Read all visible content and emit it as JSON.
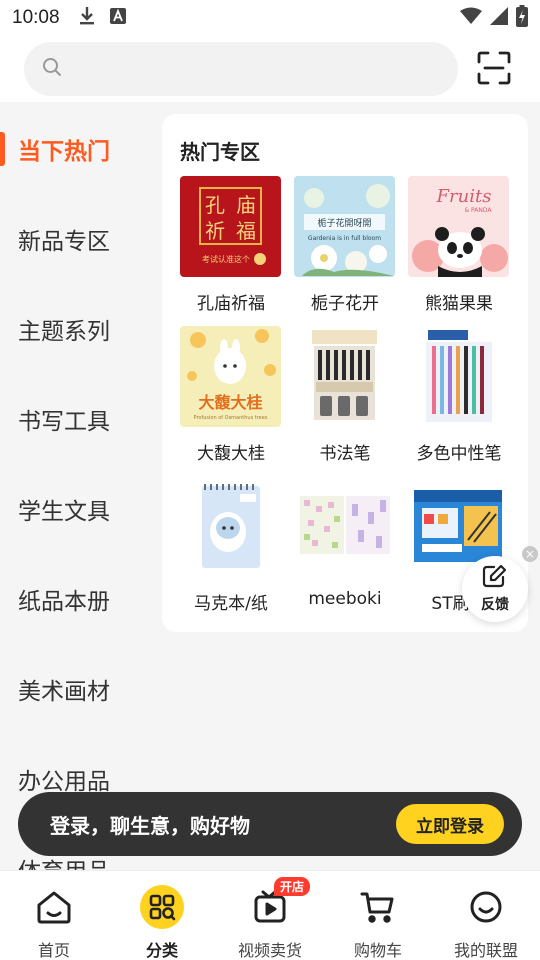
{
  "status_bar": {
    "time": "10:08"
  },
  "search": {
    "placeholder": ""
  },
  "sidebar": {
    "items": [
      {
        "label": "当下热门",
        "active": true
      },
      {
        "label": "新品专区",
        "active": false
      },
      {
        "label": "主题系列",
        "active": false
      },
      {
        "label": "书写工具",
        "active": false
      },
      {
        "label": "学生文具",
        "active": false
      },
      {
        "label": "纸品本册",
        "active": false
      },
      {
        "label": "美术画材",
        "active": false
      },
      {
        "label": "办公用品",
        "active": false
      },
      {
        "label": "体育用品",
        "active": false
      }
    ]
  },
  "content": {
    "section_title": "热门专区",
    "products": [
      {
        "name": "孔庙祈福",
        "thumb_text": [
          "孔",
          "庙",
          "祈",
          "福"
        ],
        "thumb_caption": "考试认准这个"
      },
      {
        "name": "栀子花开",
        "thumb_text": [
          "栀子花開呀開"
        ],
        "thumb_caption": "Gardenia is in full bloom"
      },
      {
        "name": "熊猫果果",
        "thumb_text": [
          "Fruits"
        ],
        "thumb_caption": "& PANDA"
      },
      {
        "name": "大馥大桂",
        "thumb_text": [
          "大馥大桂"
        ],
        "thumb_caption": "Profusion of Osmanthus trees"
      },
      {
        "name": "书法笔",
        "thumb_text": [],
        "thumb_caption": ""
      },
      {
        "name": "多色中性笔",
        "thumb_text": [],
        "thumb_caption": ""
      },
      {
        "name": "马克本/纸",
        "thumb_text": [],
        "thumb_caption": ""
      },
      {
        "name": "meeboki",
        "thumb_text": [],
        "thumb_caption": ""
      },
      {
        "name": "ST刷题",
        "thumb_text": [],
        "thumb_caption": ""
      }
    ]
  },
  "feedback": {
    "label": "反馈"
  },
  "login_banner": {
    "text": "登录，聊生意，购好物",
    "button_label": "立即登录"
  },
  "bottom_nav": {
    "items": [
      {
        "label": "首页",
        "icon": "home-icon",
        "active": false
      },
      {
        "label": "分类",
        "icon": "category-icon",
        "active": true
      },
      {
        "label": "视频卖货",
        "icon": "video-icon",
        "active": false,
        "badge": "开店"
      },
      {
        "label": "购物车",
        "icon": "cart-icon",
        "active": false
      },
      {
        "label": "我的联盟",
        "icon": "profile-icon",
        "active": false
      }
    ]
  },
  "colors": {
    "accent": "#ff5a1f",
    "login_button": "#ffd21f",
    "banner_bg": "#333333",
    "badge": "#ff3b30"
  }
}
